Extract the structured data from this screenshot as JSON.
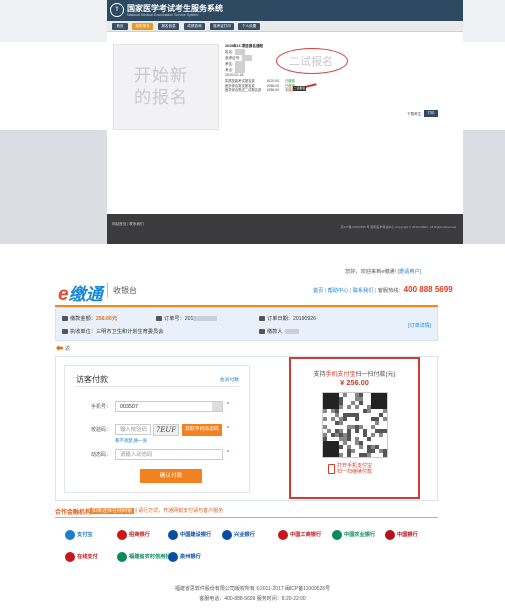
{
  "top": {
    "system_title": "国家医学考试考生服务系统",
    "system_subtitle": "National Medical Examination Service System",
    "nav": [
      "首页",
      "我的报名",
      "报名信息",
      "成绩查询",
      "准考证打印",
      "个人设置"
    ],
    "placeholder_text": "开始新的报名",
    "reg_heading": "2019年16 项目报名通知",
    "reg_lines": [
      "姓名:",
      "准考证号:",
      "考区:",
      "考点:",
      "2019-02-18"
    ],
    "fees": [
      {
        "name": "实践技能考试报名费",
        "amount": "¥120.00",
        "status": "已缴费"
      },
      {
        "name": "医学综合笔试报名费",
        "amount": "¥256.00",
        "status": "已缴费"
      },
      {
        "name": "医学综合笔试二试报名费",
        "amount": "¥256.00",
        "status": "未缴费"
      }
    ],
    "oval_text": "二试报名",
    "exam_btn": "二试报名",
    "next_text": "下载考生",
    "next_btn": "打印",
    "footer_left": "网站首页 | 联系我们",
    "footer_right": "京ICP备 09040395 号 国家医学考试中心 Copyright © 2019 NMEC. All Rights Reserved."
  },
  "cashier": {
    "brand_e": "e",
    "brand_name": "缴通",
    "brand_sub": "收银台",
    "welcome": "您好，欢迎来到e缴通!",
    "welcome_link": "[邀请用户]",
    "links": [
      "首页",
      "帮助中心",
      "联系我们"
    ],
    "hotline_label": "客服热线：",
    "hotline": "400 888 5699",
    "order": {
      "amount_label": "缴款金额：",
      "amount": "256.00元",
      "order_label": "订单号：",
      "order_value": "201",
      "date_label": "订单日期：",
      "date_value": "20190926",
      "payee_label": "执收单位：",
      "payee_value": "三明市卫生和计划生育委员会",
      "payer_label": "缴款人",
      "detail_link": "[订单详情]"
    },
    "back": "返",
    "visitor": {
      "title": "访客付款",
      "login_link": "会员付款",
      "phone_label": "手机号：",
      "phone_value": "003507",
      "captcha_label": "校验码：",
      "captcha_placeholder": "输入校验码",
      "captcha_image": "7EUF",
      "sms_button": "获取手机动态码",
      "refresh_link": "看不清楚,换一张",
      "dynamic_label": "动态码：",
      "dynamic_placeholder": "请输入动态码",
      "confirm": "确认付款"
    },
    "qr": {
      "title_prefix": "支持",
      "title_hl": "手机支付宝",
      "title_suffix": "扫一扫付款(元)",
      "amount": "¥ 256.00",
      "hint1": "打开手机支付宝",
      "hint2": "扫一扫继续付款"
    },
    "bank_head": "合作金融机构",
    "bank_tip1": "如果选择在线网银",
    "bank_tip2": "请行方式，开通网银支付请与客户服务",
    "banks": [
      {
        "name": "支付宝",
        "color": "#1a7fd0"
      },
      {
        "name": "招商银行",
        "color": "#c8161d"
      },
      {
        "name": "中国建设银行",
        "color": "#0a4da3"
      },
      {
        "name": "兴业银行",
        "color": "#0a4da3"
      },
      {
        "name": "中国工商银行",
        "color": "#c8161d"
      },
      {
        "name": "中国农业银行",
        "color": "#0a8a5a"
      },
      {
        "name": "中国银行",
        "color": "#b5121b"
      },
      {
        "name": "在线支付",
        "color": "#c8161d"
      },
      {
        "name": "福建省农村信用社",
        "color": "#0a8a5a"
      },
      {
        "name": "泉州银行",
        "color": "#0a4da3"
      }
    ],
    "footer1": "福建省思软件股份有限公司版权所有 ©2011-2017 闽ICP备11009526号",
    "footer2": "客服电话：400-888-5699 服务时间：8:20-22:00"
  }
}
